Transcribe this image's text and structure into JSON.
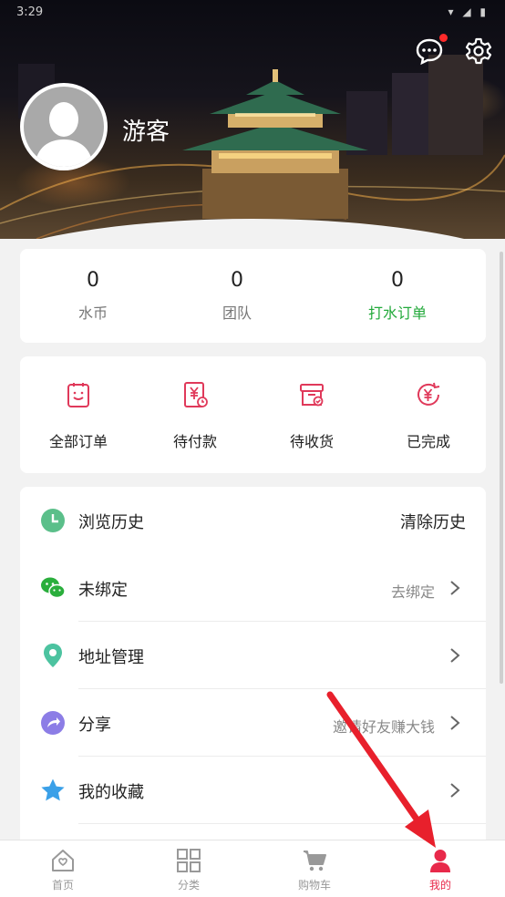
{
  "status_bar": {
    "time": "3:29",
    "icons": "▾ ◢ ▮"
  },
  "header": {
    "username": "游客",
    "has_unread_message": true
  },
  "stats": [
    {
      "value": "0",
      "label": "水币"
    },
    {
      "value": "0",
      "label": "团队"
    },
    {
      "value": "0",
      "label": "打水订单"
    }
  ],
  "orders": [
    {
      "label": "全部订单",
      "icon": "clipboard-icon"
    },
    {
      "label": "待付款",
      "icon": "yuan-bill-icon"
    },
    {
      "label": "待收货",
      "icon": "box-check-icon"
    },
    {
      "label": "已完成",
      "icon": "yuan-refresh-icon"
    }
  ],
  "menu": [
    {
      "label": "浏览历史",
      "right": "清除历史",
      "icon": "clock-icon"
    },
    {
      "label": "未绑定",
      "right": "去绑定",
      "icon": "wechat-icon"
    },
    {
      "label": "地址管理",
      "right": "",
      "icon": "location-icon"
    },
    {
      "label": "分享",
      "right": "邀请好友赚大钱",
      "icon": "share-icon"
    },
    {
      "label": "我的收藏",
      "right": "",
      "icon": "star-icon"
    }
  ],
  "nav": [
    {
      "label": "首页",
      "icon": "home-icon"
    },
    {
      "label": "分类",
      "icon": "grid-icon"
    },
    {
      "label": "购物车",
      "icon": "cart-icon"
    },
    {
      "label": "我的",
      "icon": "person-icon"
    }
  ],
  "colors": {
    "accent": "#e8294a",
    "green": "#22a93a",
    "order_icon": "#e0395a"
  }
}
